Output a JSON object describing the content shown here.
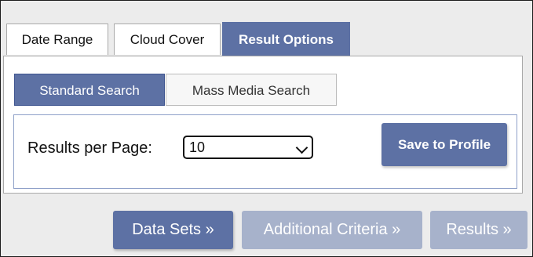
{
  "tabs": [
    {
      "label": "Date Range"
    },
    {
      "label": "Cloud Cover"
    },
    {
      "label": "Result Options",
      "active": true
    }
  ],
  "sub_tabs": [
    {
      "label": "Standard Search",
      "active": true
    },
    {
      "label": "Mass Media Search"
    }
  ],
  "result_options": {
    "results_per_page_label": "Results per Page:",
    "results_per_page_value": "10",
    "save_label": "Save to Profile"
  },
  "nav": {
    "data_sets": "Data Sets »",
    "additional_criteria": "Additional Criteria »",
    "results": "Results »"
  },
  "colors": {
    "accent": "#5d71a4",
    "accent_disabled": "#a7b2cb"
  }
}
